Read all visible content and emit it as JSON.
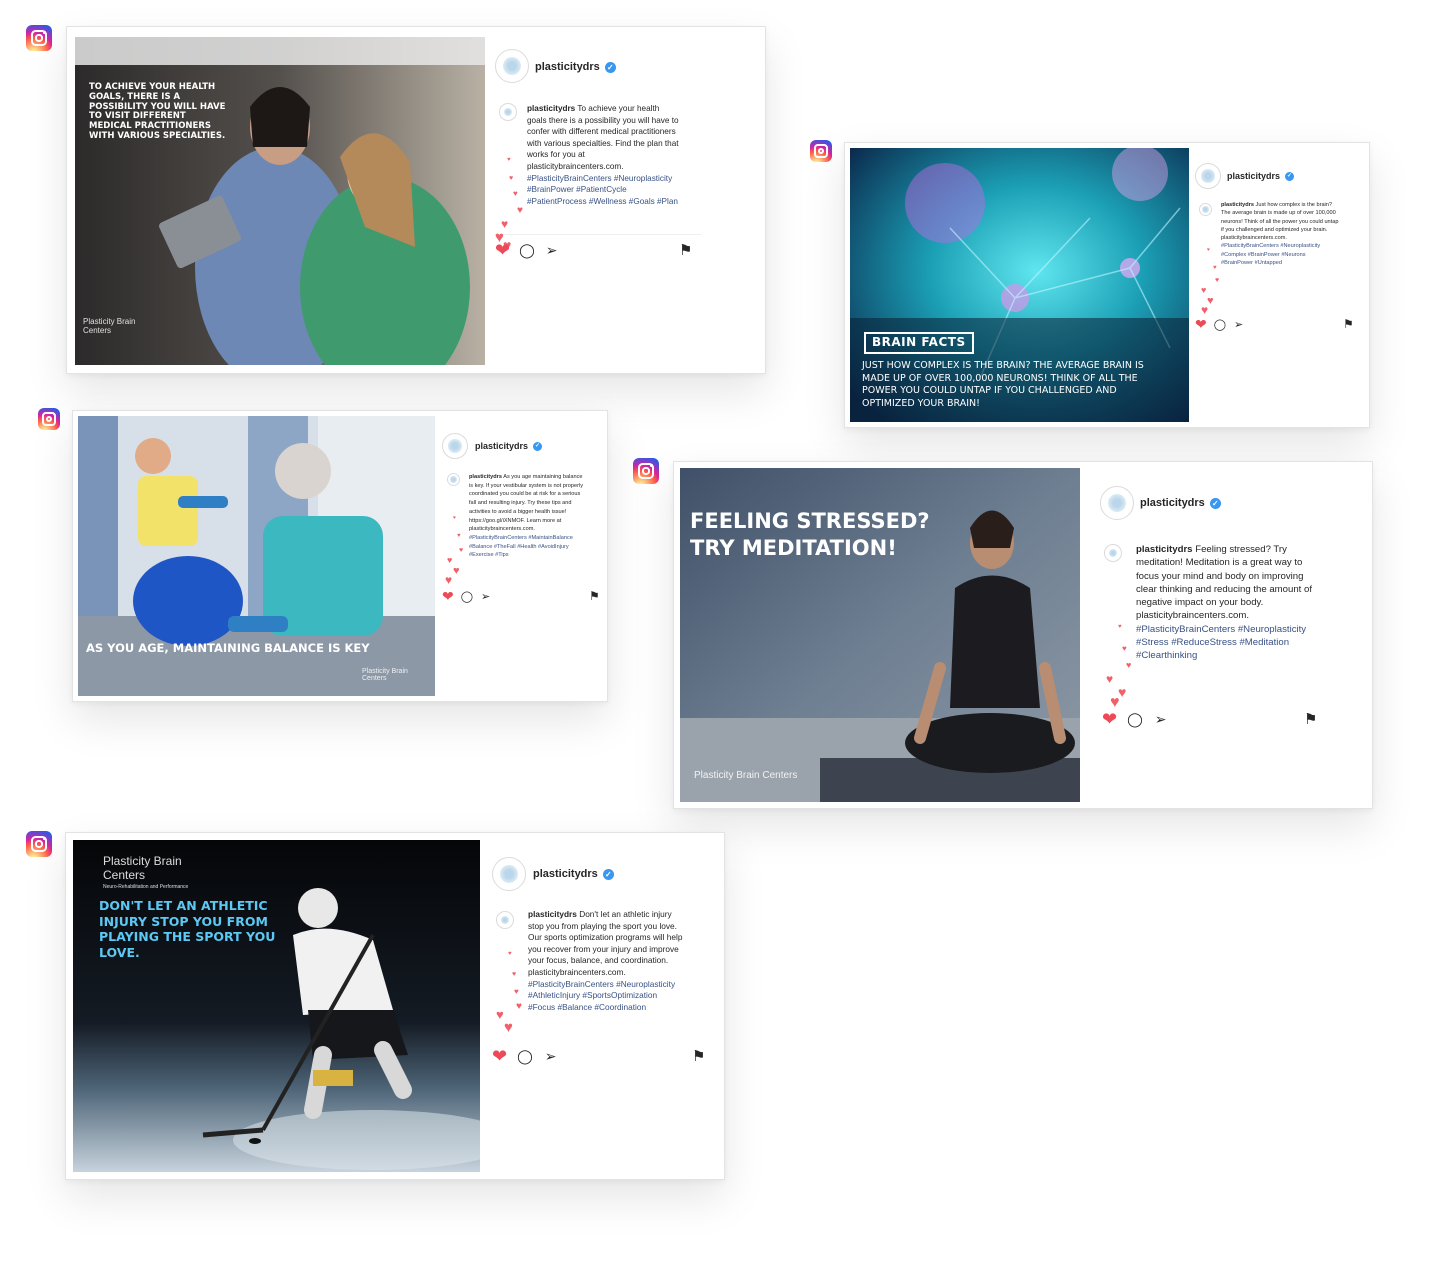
{
  "posts": [
    {
      "handle": "plasticitydrs",
      "verified_mark": "✓",
      "overlay": "TO ACHIEVE YOUR HEALTH GOALS, THERE IS A POSSIBILITY YOU WILL HAVE TO VISIT DIFFERENT MEDICAL PRACTITIONERS WITH VARIOUS SPECIALTIES.",
      "caption_user": "plasticitydrs",
      "caption_text": "To achieve your health goals there is a possibility you will have to confer with different medical practitioners with various specialties. Find the plan that works for you at plasticitybraincenters.com.",
      "tags": "#PlasticityBrainCenters #Neuroplasticity #BrainPower #PatientCycle #PatientProcess #Wellness #Goals #Plan",
      "brand": "Plasticity Brain Centers"
    },
    {
      "handle": "plasticitydrs",
      "verified_mark": "✓",
      "overlay_badge": "BRAIN FACTS",
      "overlay": "JUST HOW COMPLEX IS THE BRAIN? THE AVERAGE BRAIN IS MADE UP OF OVER 100,000 NEURONS! THINK OF ALL THE POWER YOU COULD UNTAP IF YOU CHALLENGED AND OPTIMIZED YOUR BRAIN!",
      "caption_user": "plasticitydrs",
      "caption_text": "Just how complex is the brain? The average brain is made up of over 100,000 neurons! Think of all the power you could untap if you challenged and optimized your brain. plasticitybraincenters.com.",
      "tags": "#PlasticityBrainCenters #Neuroplasticity #Complex #BrainPower #Neurons #BrainPower #Untapped"
    },
    {
      "handle": "plasticitydrs",
      "verified_mark": "✓",
      "overlay": "AS YOU AGE, MAINTAINING BALANCE IS KEY",
      "caption_user": "plasticitydrs",
      "caption_text": "As you age maintaining balance is key. If your vestibular system is not properly coordinated you could be at risk for a serious fall and resulting injury. Try these tips and activities to avoid a bigger health issue! https://goo.gl/iXNMOF. Learn more at plasticitybraincenters.com.",
      "tags": "#PlasticityBrainCenters #MaintainBalance #Balance #TheFall #Health #AvoidInjury #Exercise #Tips",
      "brand": "Plasticity Brain Centers"
    },
    {
      "handle": "plasticitydrs",
      "verified_mark": "✓",
      "overlay": "FEELING STRESSED? TRY MEDITATION!",
      "caption_user": "plasticitydrs",
      "caption_text": "Feeling stressed? Try meditation! Meditation is a great way to focus your mind and body on improving clear thinking and reducing the amount of negative impact on your body. plasticitybraincenters.com.",
      "tags": "#PlasticityBrainCenters #Neuroplasticity #Stress #ReduceStress #Meditation #Clearthinking",
      "brand": "Plasticity Brain Centers"
    },
    {
      "handle": "plasticitydrs",
      "verified_mark": "✓",
      "overlay": "DON'T LET AN ATHLETIC INJURY STOP YOU FROM PLAYING THE SPORT YOU LOVE.",
      "caption_user": "plasticitydrs",
      "caption_text": "Don't let an athletic injury stop you from playing the sport you love. Our sports optimization programs will help you recover from your injury and improve your focus, balance, and coordination. plasticitybraincenters.com.",
      "tags": "#PlasticityBrainCenters #Neuroplasticity #AthleticInjury #SportsOptimization #Focus #Balance #Coordination",
      "brand": "Plasticity Brain Centers",
      "brand_sub": "Neuro-Rehabilitation and Performance"
    }
  ],
  "icons": {
    "heart": "❤",
    "small_heart": "♥",
    "comment": "◯",
    "share": "➢",
    "save": "⚑"
  },
  "colors": {
    "instagram_gradient": [
      "#fdf497",
      "#fd5949",
      "#d6249f",
      "#285AEB"
    ],
    "like_red": "#ed4956",
    "tag_blue": "#385185",
    "verified_blue": "#3897f0"
  }
}
